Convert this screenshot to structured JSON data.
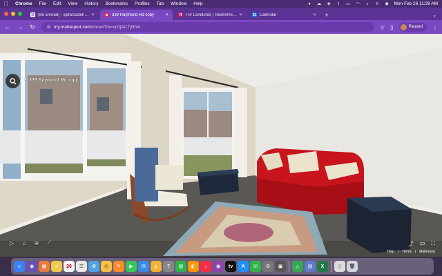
{
  "menubar": {
    "apple": "",
    "items": [
      "Chrome",
      "File",
      "Edit",
      "View",
      "History",
      "Bookmarks",
      "Profiles",
      "Tab",
      "Window",
      "Help"
    ],
    "datetime": "Mon Feb 26  11:39 AM"
  },
  "tabs": [
    {
      "title": "(86 unread) - sjafarzadeh@...",
      "favicon": "mail-icon",
      "color": "#7b4bd1",
      "active": false
    },
    {
      "title": "339 Raymond Rd copy",
      "favicon": "matterport-icon",
      "color": "#e0245e",
      "active": true
    },
    {
      "title": "For Landlords | Redeemer Ur...",
      "favicon": "redeemer-icon",
      "color": "#c2185b",
      "active": false
    },
    {
      "title": "Calendar",
      "favicon": "calendar-icon",
      "color": "#1a73e8",
      "active": false
    }
  ],
  "toolbar": {
    "url_host": "my.matterport.com",
    "url_path": "/show/?m=qrDjACTjNhm",
    "profile_label": "Paused"
  },
  "viewer": {
    "room_title": "339 Raymond Rd copy",
    "help_label": "Help",
    "terms_label": "Terms",
    "brand_label": "Matterport"
  },
  "dock": {
    "calendar_day": "26",
    "calendar_month": "FEB"
  },
  "colors": {
    "menubar": "#4a2c73",
    "tabstrip": "#5b3394",
    "toolbar": "#7a49c2",
    "sofa": "#c8141c"
  }
}
